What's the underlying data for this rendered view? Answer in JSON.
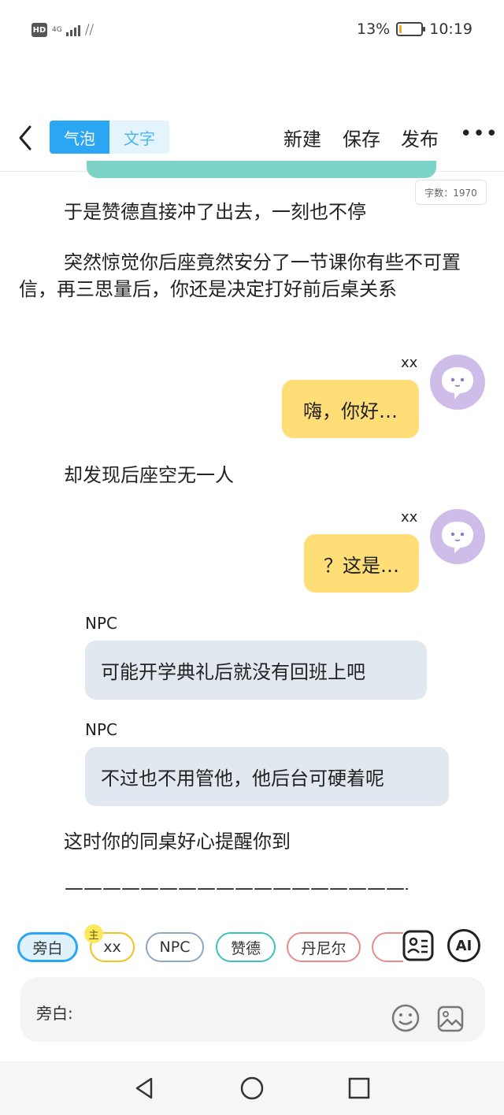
{
  "status_bar": {
    "hd": "HD",
    "network": "4G",
    "battery_percent": "13%",
    "battery_level": 0.13,
    "time": "10:19"
  },
  "app_bar": {
    "back_icon": "chevron-left-icon",
    "mode_tabs": [
      "气泡",
      "文字"
    ],
    "active_mode": "气泡",
    "actions": [
      "新建",
      "保存",
      "发布"
    ],
    "more_icon": "more-horizontal-icon"
  },
  "word_count": "字数：1970",
  "messages": [
    {
      "type": "narration",
      "text": "于是赞德直接冲了出去，一刻也不停"
    },
    {
      "type": "narration",
      "text": "突然惊觉你后座竟然安分了一节课你有些不可置信，再三思量后，你还是决定打好前后桌关系"
    },
    {
      "type": "bubble_right",
      "speaker": "xx",
      "text": "嗨，你好…"
    },
    {
      "type": "narration",
      "text": "却发现后座空无一人"
    },
    {
      "type": "bubble_right",
      "speaker": "xx",
      "text": "？这是…"
    },
    {
      "type": "bubble_left",
      "speaker": "NPC",
      "text": "可能开学典礼后就没有回班上吧"
    },
    {
      "type": "bubble_left",
      "speaker": "NPC",
      "text": "不过也不用管他，他后台可硬着呢"
    },
    {
      "type": "narration",
      "text": "这时你的同桌好心提醒你到"
    },
    {
      "type": "narration",
      "text": "——————————————————————"
    }
  ],
  "characters": [
    {
      "label": "旁白",
      "selected": true,
      "color": "#2aa6f2"
    },
    {
      "label": "xx",
      "badge": "主",
      "color": "#f3c21c"
    },
    {
      "label": "NPC",
      "color": "#8ea6c6"
    },
    {
      "label": "赞德",
      "color": "#3cc2b6"
    },
    {
      "label": "丹尼尔",
      "color": "#e78b8b"
    }
  ],
  "toolbar_icons": [
    "role-card-icon",
    "ai-icon"
  ],
  "ai_label": "AI",
  "input": {
    "label": "旁白:",
    "icons": [
      "emoji-icon",
      "image-icon"
    ]
  },
  "nav_icons": [
    "back-triangle-icon",
    "home-circle-icon",
    "recent-square-icon"
  ]
}
